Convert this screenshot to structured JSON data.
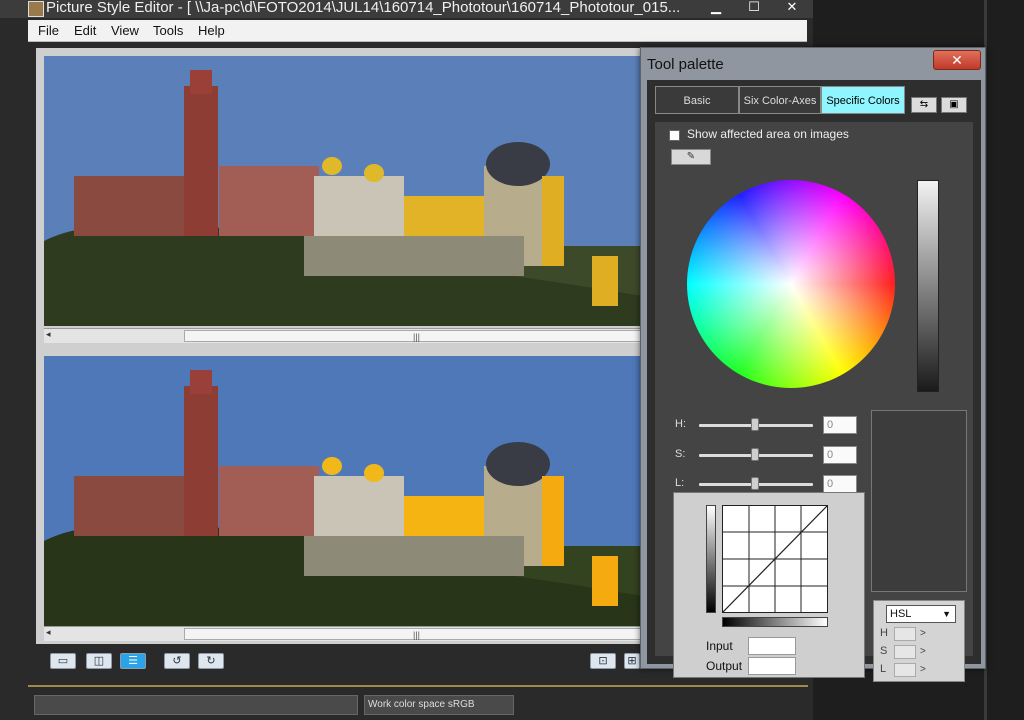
{
  "window": {
    "title": "Picture Style Editor - [ \\\\Ja-pc\\d\\FOTO2014\\JUL14\\160714_Phototour\\160714_Phototour_015...",
    "minimize": "▁",
    "maximize": "☐",
    "close": "✕"
  },
  "menu": {
    "file": "File",
    "edit": "Edit",
    "view": "View",
    "tools": "Tools",
    "help": "Help"
  },
  "status": {
    "color_space": "Work color space  sRGB"
  },
  "palette": {
    "title": "Tool palette",
    "close": "✕",
    "tabs": {
      "basic": "Basic",
      "six_axes": "Six Color-Axes",
      "specific": "Specific Colors"
    },
    "show_affected_label": "Show affected area on images",
    "sliders": {
      "h_label": "H:",
      "h_value": "0",
      "s_label": "S:",
      "s_value": "0",
      "l_label": "L:",
      "l_value": "0"
    },
    "input_label": "Input",
    "output_label": "Output",
    "mode_selected": "HSL",
    "hsl_rows": {
      "h": "H",
      "s": "S",
      "l": "L"
    }
  },
  "colors": {
    "accent": "#8ff5ff",
    "toolbar_active": "#2aa3e8",
    "close_red": "#c0392b"
  }
}
